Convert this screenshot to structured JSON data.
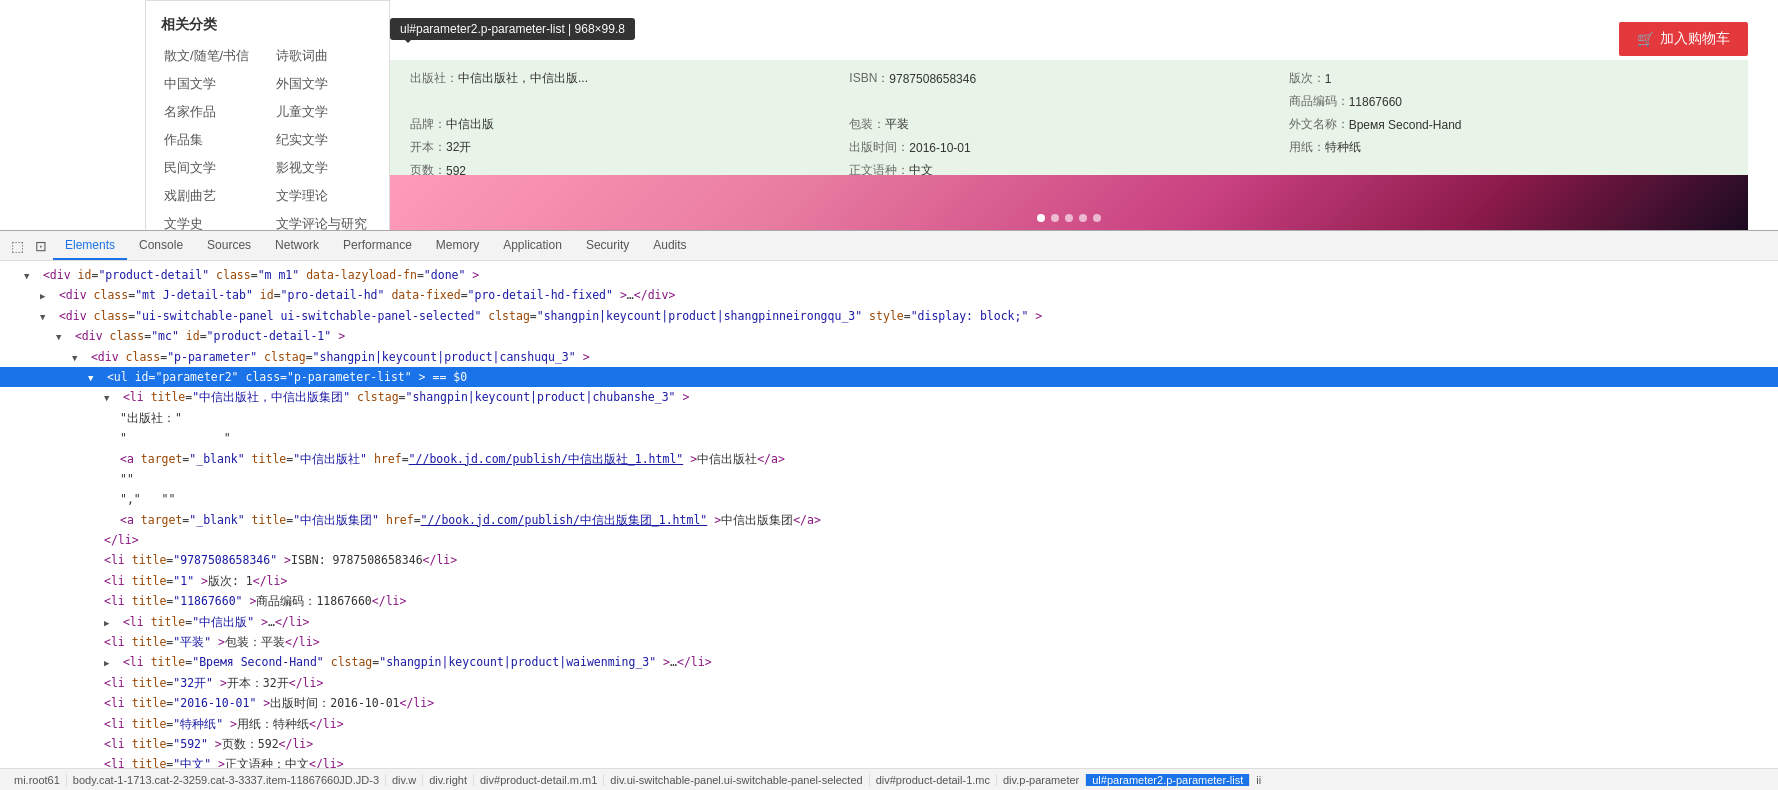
{
  "page": {
    "tooltip": {
      "selector": "ul#parameter2.p-parameter-list",
      "dimensions": "968×99.8"
    },
    "add_to_cart": "加入购物车",
    "cart_icon": "🛒"
  },
  "category": {
    "title": "相关分类",
    "items": [
      {
        "label": "散文/随笔/书信",
        "col": 1
      },
      {
        "label": "诗歌词曲",
        "col": 2
      },
      {
        "label": "中国文学",
        "col": 1
      },
      {
        "label": "外国文学",
        "col": 2
      },
      {
        "label": "名家作品",
        "col": 1
      },
      {
        "label": "儿童文学",
        "col": 2
      },
      {
        "label": "作品集",
        "col": 1
      },
      {
        "label": "纪实文学",
        "col": 2
      },
      {
        "label": "民间文学",
        "col": 1
      },
      {
        "label": "影视文学",
        "col": 2
      },
      {
        "label": "戏剧曲艺",
        "col": 1
      },
      {
        "label": "文学理论",
        "col": 2
      },
      {
        "label": "文学史",
        "col": 1
      },
      {
        "label": "文学评论与研究",
        "col": 2
      }
    ]
  },
  "product_info": {
    "fields": [
      {
        "label": "出版社：",
        "value": "中信出版社，中信出版..."
      },
      {
        "label": "ISBN：",
        "value": "9787508658346"
      },
      {
        "label": "版次：",
        "value": "1"
      },
      {
        "label": "商品编码：",
        "value": "11867660"
      },
      {
        "label": "品牌：",
        "value": "中信出版"
      },
      {
        "label": "包装：",
        "value": "平装"
      },
      {
        "label": "外文名称：",
        "value": "Время Second-Hand"
      },
      {
        "label": "开本：",
        "value": "32开"
      },
      {
        "label": "出版时间：",
        "value": "2016-10-01"
      },
      {
        "label": "用纸：",
        "value": "特种纸"
      },
      {
        "label": "页数：",
        "value": "592"
      },
      {
        "label": "正文语种：",
        "value": "中文"
      }
    ]
  },
  "devtools": {
    "tabs": [
      {
        "label": "Elements",
        "active": true
      },
      {
        "label": "Console",
        "active": false
      },
      {
        "label": "Sources",
        "active": false
      },
      {
        "label": "Network",
        "active": false
      },
      {
        "label": "Performance",
        "active": false
      },
      {
        "label": "Memory",
        "active": false
      },
      {
        "label": "Application",
        "active": false
      },
      {
        "label": "Security",
        "active": false
      },
      {
        "label": "Audits",
        "active": false
      }
    ],
    "dom_lines": [
      {
        "id": "line1",
        "indent": "indent1",
        "content": "<div id=\"product-detail\" class=\"m m1\" data-lazyload-fn=\"done\">",
        "selected": false
      },
      {
        "id": "line2",
        "indent": "indent2",
        "content": "<div class=\"mt J-detail-tab\" id=\"pro-detail-hd\" data-fixed=\"pro-detail-hd-fixed\">…</div>",
        "selected": false
      },
      {
        "id": "line3",
        "indent": "indent2",
        "content": "<div class=\"ui-switchable-panel ui-switchable-panel-selected\" clstag=\"shangpin|keycount|product|shangpinneirongqu_3\" style=\"display: block;\">",
        "selected": false
      },
      {
        "id": "line4",
        "indent": "indent3",
        "content": "<div class=\"mc\" id=\"product-detail-1\">",
        "selected": false
      },
      {
        "id": "line5",
        "indent": "indent4",
        "content": "<div class=\"p-parameter\" clstag=\"shangpin|keycount|product|canshuqu_3\">",
        "selected": false
      },
      {
        "id": "line6",
        "indent": "indent5",
        "content": "<ul id=\"parameter2\" class=\"p-parameter-list\"> == $0",
        "selected": true
      },
      {
        "id": "line7",
        "indent": "indent6",
        "content": "<li title=\"中信出版社，中信出版集团\" clstag=\"shangpin|keycount|product|chubanshe_3\">",
        "selected": false
      },
      {
        "id": "line8",
        "indent": "indent7",
        "content": "\"出版社：\"",
        "selected": false
      },
      {
        "id": "line9",
        "indent": "indent7",
        "content": "\"              \"",
        "selected": false
      },
      {
        "id": "line10",
        "indent": "indent7",
        "content": "<a target=\"_blank\" title=\"中信出版社\" href=\"//book.jd.com/publish/中信出版社_1.html\">中信出版社</a>",
        "selected": false
      },
      {
        "id": "line11",
        "indent": "indent7",
        "content": "\"\"",
        "selected": false
      },
      {
        "id": "line12",
        "indent": "indent7",
        "content": "\",\"   \"\"",
        "selected": false
      },
      {
        "id": "line13",
        "indent": "indent7",
        "content": "<a target=\"_blank\" title=\"中信出版集团\" href=\"//book.jd.com/publish/中信出版集团_1.html\">中信出版集团</a>",
        "selected": false
      },
      {
        "id": "line14",
        "indent": "indent6",
        "content": "</li>",
        "selected": false
      },
      {
        "id": "line15",
        "indent": "indent6",
        "content": "<li title=\"9787508658346\">ISBN: 9787508658346</li>",
        "selected": false
      },
      {
        "id": "line16",
        "indent": "indent6",
        "content": "<li title=\"1\">版次: 1</li>",
        "selected": false
      },
      {
        "id": "line17",
        "indent": "indent6",
        "content": "<li title=\"11867660\">商品编码：11867660</li>",
        "selected": false
      },
      {
        "id": "line18",
        "indent": "indent6",
        "content": "<li title=\"中信出版\">…</li>",
        "selected": false
      },
      {
        "id": "line19",
        "indent": "indent6",
        "content": "<li title=\"平装\">包装：平装</li>",
        "selected": false
      },
      {
        "id": "line20",
        "indent": "indent6",
        "content": "<li title=\"Время Second-Hand\" clstag=\"shangpin|keycount|product|waiwenming_3\">…</li>",
        "selected": false
      },
      {
        "id": "line21",
        "indent": "indent6",
        "content": "<li title=\"32开\">开本：32开</li>",
        "selected": false
      },
      {
        "id": "line22",
        "indent": "indent6",
        "content": "<li title=\"2016-10-01\">出版时间：2016-10-01</li>",
        "selected": false
      },
      {
        "id": "line23",
        "indent": "indent6",
        "content": "<li title=\"特种纸\">用纸：特种纸</li>",
        "selected": false
      },
      {
        "id": "line24",
        "indent": "indent6",
        "content": "<li title=\"592\">页数：592</li>",
        "selected": false
      },
      {
        "id": "line25",
        "indent": "indent6",
        "content": "<li title=\"中文\">正文语种：中文</li>",
        "selected": false
      }
    ],
    "status_bar": [
      {
        "label": "mi.root61",
        "highlighted": false
      },
      {
        "label": "body.cat-1-1713.cat-2-3259.cat-3-3337.item-11867660JD.JD-3",
        "highlighted": false
      },
      {
        "label": "div.w",
        "highlighted": false
      },
      {
        "label": "div.right",
        "highlighted": false
      },
      {
        "label": "div#product-detail.m.m1",
        "highlighted": false
      },
      {
        "label": "div.ui-switchable-panel.ui-switchable-panel-selected",
        "highlighted": false
      },
      {
        "label": "div#product-detail-1.mc",
        "highlighted": false
      },
      {
        "label": "div.p-parameter",
        "highlighted": false
      },
      {
        "label": "ul#parameter2.p-parameter-list",
        "highlighted": true
      },
      {
        "label": "ii",
        "highlighted": false
      }
    ]
  }
}
